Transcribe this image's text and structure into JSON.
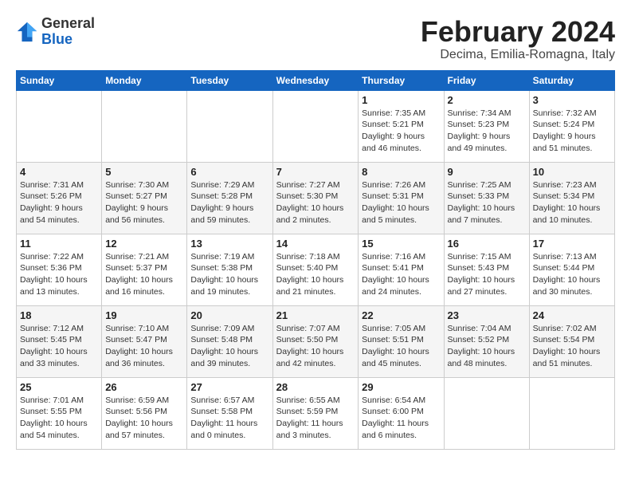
{
  "logo": {
    "general": "General",
    "blue": "Blue"
  },
  "title": {
    "month": "February 2024",
    "location": "Decima, Emilia-Romagna, Italy"
  },
  "days_of_week": [
    "Sunday",
    "Monday",
    "Tuesday",
    "Wednesday",
    "Thursday",
    "Friday",
    "Saturday"
  ],
  "weeks": [
    [
      {
        "day": "",
        "info": ""
      },
      {
        "day": "",
        "info": ""
      },
      {
        "day": "",
        "info": ""
      },
      {
        "day": "",
        "info": ""
      },
      {
        "day": "1",
        "info": "Sunrise: 7:35 AM\nSunset: 5:21 PM\nDaylight: 9 hours and 46 minutes."
      },
      {
        "day": "2",
        "info": "Sunrise: 7:34 AM\nSunset: 5:23 PM\nDaylight: 9 hours and 49 minutes."
      },
      {
        "day": "3",
        "info": "Sunrise: 7:32 AM\nSunset: 5:24 PM\nDaylight: 9 hours and 51 minutes."
      }
    ],
    [
      {
        "day": "4",
        "info": "Sunrise: 7:31 AM\nSunset: 5:26 PM\nDaylight: 9 hours and 54 minutes."
      },
      {
        "day": "5",
        "info": "Sunrise: 7:30 AM\nSunset: 5:27 PM\nDaylight: 9 hours and 56 minutes."
      },
      {
        "day": "6",
        "info": "Sunrise: 7:29 AM\nSunset: 5:28 PM\nDaylight: 9 hours and 59 minutes."
      },
      {
        "day": "7",
        "info": "Sunrise: 7:27 AM\nSunset: 5:30 PM\nDaylight: 10 hours and 2 minutes."
      },
      {
        "day": "8",
        "info": "Sunrise: 7:26 AM\nSunset: 5:31 PM\nDaylight: 10 hours and 5 minutes."
      },
      {
        "day": "9",
        "info": "Sunrise: 7:25 AM\nSunset: 5:33 PM\nDaylight: 10 hours and 7 minutes."
      },
      {
        "day": "10",
        "info": "Sunrise: 7:23 AM\nSunset: 5:34 PM\nDaylight: 10 hours and 10 minutes."
      }
    ],
    [
      {
        "day": "11",
        "info": "Sunrise: 7:22 AM\nSunset: 5:36 PM\nDaylight: 10 hours and 13 minutes."
      },
      {
        "day": "12",
        "info": "Sunrise: 7:21 AM\nSunset: 5:37 PM\nDaylight: 10 hours and 16 minutes."
      },
      {
        "day": "13",
        "info": "Sunrise: 7:19 AM\nSunset: 5:38 PM\nDaylight: 10 hours and 19 minutes."
      },
      {
        "day": "14",
        "info": "Sunrise: 7:18 AM\nSunset: 5:40 PM\nDaylight: 10 hours and 21 minutes."
      },
      {
        "day": "15",
        "info": "Sunrise: 7:16 AM\nSunset: 5:41 PM\nDaylight: 10 hours and 24 minutes."
      },
      {
        "day": "16",
        "info": "Sunrise: 7:15 AM\nSunset: 5:43 PM\nDaylight: 10 hours and 27 minutes."
      },
      {
        "day": "17",
        "info": "Sunrise: 7:13 AM\nSunset: 5:44 PM\nDaylight: 10 hours and 30 minutes."
      }
    ],
    [
      {
        "day": "18",
        "info": "Sunrise: 7:12 AM\nSunset: 5:45 PM\nDaylight: 10 hours and 33 minutes."
      },
      {
        "day": "19",
        "info": "Sunrise: 7:10 AM\nSunset: 5:47 PM\nDaylight: 10 hours and 36 minutes."
      },
      {
        "day": "20",
        "info": "Sunrise: 7:09 AM\nSunset: 5:48 PM\nDaylight: 10 hours and 39 minutes."
      },
      {
        "day": "21",
        "info": "Sunrise: 7:07 AM\nSunset: 5:50 PM\nDaylight: 10 hours and 42 minutes."
      },
      {
        "day": "22",
        "info": "Sunrise: 7:05 AM\nSunset: 5:51 PM\nDaylight: 10 hours and 45 minutes."
      },
      {
        "day": "23",
        "info": "Sunrise: 7:04 AM\nSunset: 5:52 PM\nDaylight: 10 hours and 48 minutes."
      },
      {
        "day": "24",
        "info": "Sunrise: 7:02 AM\nSunset: 5:54 PM\nDaylight: 10 hours and 51 minutes."
      }
    ],
    [
      {
        "day": "25",
        "info": "Sunrise: 7:01 AM\nSunset: 5:55 PM\nDaylight: 10 hours and 54 minutes."
      },
      {
        "day": "26",
        "info": "Sunrise: 6:59 AM\nSunset: 5:56 PM\nDaylight: 10 hours and 57 minutes."
      },
      {
        "day": "27",
        "info": "Sunrise: 6:57 AM\nSunset: 5:58 PM\nDaylight: 11 hours and 0 minutes."
      },
      {
        "day": "28",
        "info": "Sunrise: 6:55 AM\nSunset: 5:59 PM\nDaylight: 11 hours and 3 minutes."
      },
      {
        "day": "29",
        "info": "Sunrise: 6:54 AM\nSunset: 6:00 PM\nDaylight: 11 hours and 6 minutes."
      },
      {
        "day": "",
        "info": ""
      },
      {
        "day": "",
        "info": ""
      }
    ]
  ]
}
